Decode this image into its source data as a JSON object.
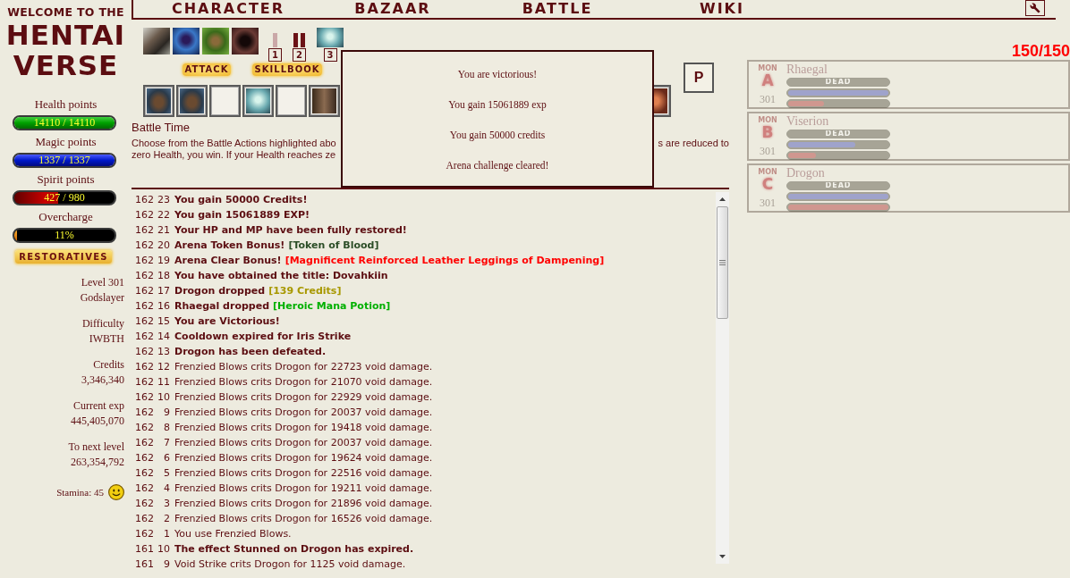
{
  "logo": {
    "tagline": "WELCOME TO THE",
    "title": [
      "HENTAI",
      "VERSE"
    ]
  },
  "nav": {
    "items": [
      "CHARACTER",
      "BAZAAR",
      "BATTLE",
      "WIKI"
    ]
  },
  "vitals": [
    {
      "kind": "health",
      "label": "Health points",
      "value": "14110 / 14110",
      "level": 1
    },
    {
      "kind": "magic",
      "label": "Magic points",
      "value": "1337 / 1337",
      "level": 1
    },
    {
      "kind": "spirit",
      "label": "Spirit points",
      "value": "427 / 980",
      "level": 0.436
    },
    {
      "kind": "overcharge",
      "label": "Overcharge",
      "value": "11%",
      "level": 0.03
    }
  ],
  "restoratives_button": "RESTORATIVES",
  "character": [
    {
      "label": "Level 301",
      "value": "Godslayer"
    },
    {
      "label": "Difficulty",
      "value": "IWBTH"
    },
    {
      "label": "Credits",
      "value": "3,346,340"
    },
    {
      "label": "Current exp",
      "value": "445,405,070"
    },
    {
      "label": "To next level",
      "value": "263,354,792"
    }
  ],
  "stamina": "Stamina: 45",
  "quickbar": [
    {
      "label": "1",
      "kind": "bar"
    },
    {
      "label": "2",
      "kind": "double-bar"
    },
    {
      "label": "3",
      "kind": "art"
    }
  ],
  "actions": [
    "ATTACK",
    "SKILLBOOK"
  ],
  "skill_slots": [
    {
      "filled": true
    },
    {
      "filled": true
    },
    {
      "filled": false
    },
    {
      "filled": true
    },
    {
      "filled": false
    },
    {
      "filled": true
    },
    {
      "filled": true
    }
  ],
  "p_button": "P",
  "battle_info": {
    "title": "Battle Time",
    "left_lines": [
      "Choose from the Battle Actions highlighted abo",
      "zero Health, you win. If your Health reaches ze"
    ],
    "right_text": "s are reduced to"
  },
  "dialog": {
    "lines": [
      "You are victorious!",
      "You gain 15061889 exp",
      "You gain 50000 credits",
      "Arena challenge cleared!"
    ]
  },
  "log": [
    {
      "turn": "162",
      "step": "23",
      "text": "You gain 50000 Credits!",
      "bold": true
    },
    {
      "turn": "162",
      "step": "22",
      "text": "You gain 15061889 EXP!",
      "bold": true
    },
    {
      "turn": "162",
      "step": "21",
      "text": "Your HP and MP have been fully restored!",
      "bold": true
    },
    {
      "turn": "162",
      "step": "20",
      "text": "Arena Token Bonus!",
      "bold": true,
      "drop": {
        "text": "[Token of Blood]",
        "color": "#2b4d26"
      }
    },
    {
      "turn": "162",
      "step": "19",
      "text": "Arena Clear Bonus!",
      "bold": true,
      "drop": {
        "text": "[Magnificent Reinforced Leather Leggings of Dampening]",
        "color": "#ff0000"
      }
    },
    {
      "turn": "162",
      "step": "18",
      "text": "You have obtained the title: Dovahkiin",
      "bold": true
    },
    {
      "turn": "162",
      "step": "17",
      "text": "Drogon dropped",
      "bold": true,
      "drop": {
        "text": "[139 Credits]",
        "color": "#a89800"
      }
    },
    {
      "turn": "162",
      "step": "16",
      "text": "Rhaegal dropped",
      "bold": true,
      "drop": {
        "text": "[Heroic Mana Potion]",
        "color": "#00b000"
      }
    },
    {
      "turn": "162",
      "step": "15",
      "text": "You are Victorious!",
      "bold": true
    },
    {
      "turn": "162",
      "step": "14",
      "text": "Cooldown expired for Iris Strike",
      "bold": true
    },
    {
      "turn": "162",
      "step": "13",
      "text": "Drogon has been defeated.",
      "bold": true
    },
    {
      "turn": "162",
      "step": "12",
      "text": "Frenzied Blows crits Drogon for 22723 void damage.",
      "bold": false
    },
    {
      "turn": "162",
      "step": "11",
      "text": "Frenzied Blows crits Drogon for 21070 void damage.",
      "bold": false
    },
    {
      "turn": "162",
      "step": "10",
      "text": "Frenzied Blows crits Drogon for 22929 void damage.",
      "bold": false
    },
    {
      "turn": "162",
      "step": "9",
      "text": "Frenzied Blows crits Drogon for 20037 void damage.",
      "bold": false
    },
    {
      "turn": "162",
      "step": "8",
      "text": "Frenzied Blows crits Drogon for 19418 void damage.",
      "bold": false
    },
    {
      "turn": "162",
      "step": "7",
      "text": "Frenzied Blows crits Drogon for 20037 void damage.",
      "bold": false
    },
    {
      "turn": "162",
      "step": "6",
      "text": "Frenzied Blows crits Drogon for 19624 void damage.",
      "bold": false
    },
    {
      "turn": "162",
      "step": "5",
      "text": "Frenzied Blows crits Drogon for 22516 void damage.",
      "bold": false
    },
    {
      "turn": "162",
      "step": "4",
      "text": "Frenzied Blows crits Drogon for 19211 void damage.",
      "bold": false
    },
    {
      "turn": "162",
      "step": "3",
      "text": "Frenzied Blows crits Drogon for 21896 void damage.",
      "bold": false
    },
    {
      "turn": "162",
      "step": "2",
      "text": "Frenzied Blows crits Drogon for 16526 void damage.",
      "bold": false
    },
    {
      "turn": "162",
      "step": "1",
      "text": "You use Frenzied Blows.",
      "bold": false
    },
    {
      "turn": "161",
      "step": "10",
      "text": "The effect Stunned on Drogon has expired.",
      "bold": true
    },
    {
      "turn": "161",
      "step": "9",
      "text": "Void Strike crits Drogon for 1125 void damage.",
      "bold": false
    }
  ],
  "monsters": {
    "counter": "150/150",
    "list": [
      {
        "tag": "MON",
        "letter": "A",
        "level_label": "301",
        "name": "Rhaegal",
        "dead": true,
        "hp": {
          "text": "DEAD"
        },
        "mp": {
          "level": 1
        },
        "sp": {
          "level": 0.36
        }
      },
      {
        "tag": "MON",
        "letter": "B",
        "level_label": "301",
        "name": "Viserion",
        "dead": true,
        "hp": {
          "text": "DEAD"
        },
        "mp": {
          "level": 0.67
        },
        "sp": {
          "level": 0.28
        }
      },
      {
        "tag": "MON",
        "letter": "C",
        "level_label": "301",
        "name": "Drogon",
        "dead": true,
        "hp": {
          "text": "DEAD"
        },
        "mp": {
          "level": 1
        },
        "sp": {
          "level": 1
        }
      }
    ]
  }
}
